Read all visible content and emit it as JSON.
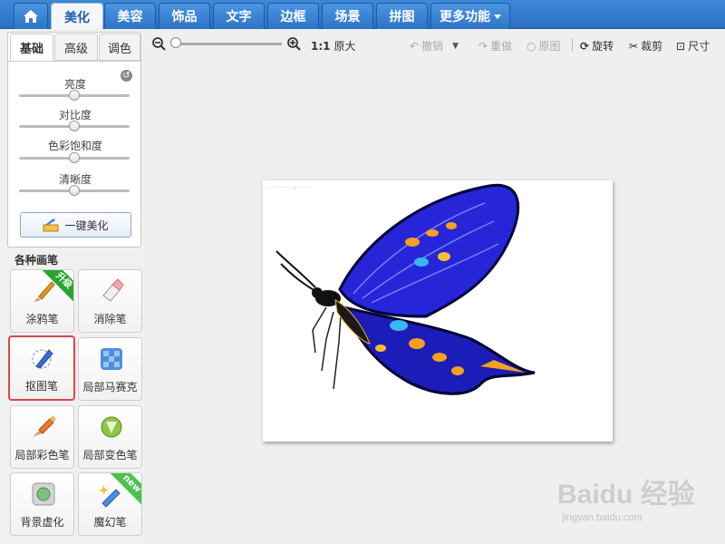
{
  "nav": {
    "home_icon": "home-icon",
    "tabs": [
      "美化",
      "美容",
      "饰品",
      "文字",
      "边框",
      "场景",
      "拼图",
      "更多功能"
    ],
    "active_tab": "美化"
  },
  "adjust": {
    "tabs": [
      "基础",
      "高级",
      "调色"
    ],
    "active_tab": "基础",
    "sliders": [
      {
        "label": "亮度",
        "level": 0.5
      },
      {
        "label": "对比度",
        "level": 0.5
      },
      {
        "label": "色彩饱和度",
        "level": 0.5
      },
      {
        "label": "清晰度",
        "level": 0.5
      }
    ],
    "auto_button": "一键美化"
  },
  "brushes": {
    "title": "各种画笔",
    "items": [
      {
        "label": "涂鸦笔",
        "icon": "brush-icon",
        "badge": "升级"
      },
      {
        "label": "消除笔",
        "icon": "eraser-icon",
        "badge": ""
      },
      {
        "label": "抠图笔",
        "icon": "cutout-pen-icon",
        "badge": ""
      },
      {
        "label": "局部马赛克",
        "icon": "mosaic-icon",
        "badge": ""
      },
      {
        "label": "局部彩色笔",
        "icon": "color-brush-icon",
        "badge": ""
      },
      {
        "label": "局部变色笔",
        "icon": "recolor-icon",
        "badge": ""
      },
      {
        "label": "背景虚化",
        "icon": "blur-icon",
        "badge": ""
      },
      {
        "label": "魔幻笔",
        "icon": "magic-pen-icon",
        "badge": "new"
      }
    ],
    "selected": "抠图笔"
  },
  "toolbar": {
    "ratio": "1:1",
    "original_size": "原大",
    "undo": "撤销",
    "redo": "重做",
    "original": "原图",
    "rotate": "旋转",
    "crop": "裁剪",
    "size": "尺寸"
  },
  "watermark": {
    "brand": "Baidu 经验",
    "url": "jingyan.baidu.com"
  },
  "colors": {
    "nav_blue": "#2b6fc0",
    "selection_red": "#e04545",
    "butterfly_blue": "#2a2adf"
  }
}
